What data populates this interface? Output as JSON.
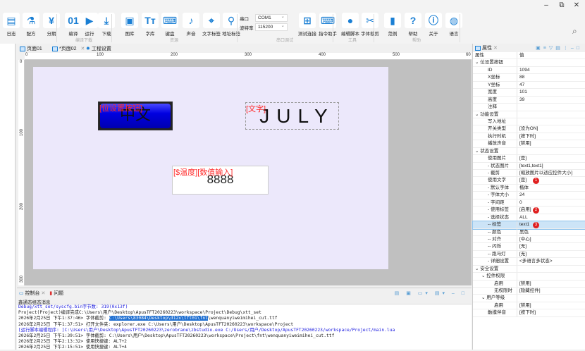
{
  "window": {
    "minimize": "–",
    "restore": "⧉",
    "close": "✕"
  },
  "ribbon": {
    "tools": [
      {
        "label": "日志",
        "icon": "log-icon",
        "glyph": "▤"
      },
      {
        "label": "配方",
        "icon": "recipe-icon",
        "glyph": "⚗"
      },
      {
        "label": "分期",
        "icon": "installment-icon",
        "glyph": "¥"
      },
      {
        "label": "编译",
        "icon": "compile-icon",
        "glyph": "01"
      },
      {
        "label": "运行",
        "icon": "run-icon",
        "glyph": "▶"
      },
      {
        "label": "下载",
        "icon": "download-icon",
        "glyph": "⤓"
      },
      {
        "label": "图库",
        "icon": "image-library-icon",
        "glyph": "▣"
      },
      {
        "label": "字库",
        "icon": "font-library-icon",
        "glyph": "Tт"
      },
      {
        "label": "键盘",
        "icon": "keyboard-icon",
        "glyph": "⌨"
      },
      {
        "label": "声音",
        "icon": "sound-icon",
        "glyph": "♪"
      },
      {
        "label": "文字标签",
        "icon": "text-tag-icon",
        "glyph": "⌖"
      },
      {
        "label": "地址标签",
        "icon": "address-tag-icon",
        "glyph": "⚲"
      },
      {
        "label": "测试连接",
        "icon": "test-connection-icon",
        "glyph": "⊞"
      },
      {
        "label": "指令助手",
        "icon": "command-helper-icon",
        "glyph": "⌨"
      },
      {
        "label": "编辑脚本",
        "icon": "lua-script-icon",
        "glyph": "●"
      },
      {
        "label": "字体裁剪",
        "icon": "scissors-icon",
        "glyph": "✂"
      },
      {
        "label": "范例",
        "icon": "bookmark-icon",
        "glyph": "▮"
      },
      {
        "label": "帮助",
        "icon": "help-icon",
        "glyph": "?"
      },
      {
        "label": "关于",
        "icon": "info-icon",
        "glyph": "ⓘ"
      },
      {
        "label": "语言",
        "icon": "globe-icon",
        "glyph": "◍"
      }
    ],
    "groups": [
      "编译下载",
      "资源",
      "串口调试",
      "工具",
      "帮助"
    ],
    "serial": {
      "port_label": "串口",
      "port_value": "COM1",
      "baud_label": "波特率",
      "baud_value": "115200"
    },
    "search": "⌕"
  },
  "tabs": [
    {
      "label": "页面01"
    },
    {
      "label": "*页面02"
    },
    {
      "label": "工程设置"
    }
  ],
  "ruler": {
    "h": [
      "0",
      "100",
      "200",
      "300",
      "400",
      "500",
      "60"
    ],
    "v": [
      "0",
      "100",
      "200",
      "300"
    ]
  },
  "canvas": {
    "button": {
      "tag": "[位设置按钮]",
      "text": "中文"
    },
    "text": {
      "tag": "[文字]",
      "text": "JULY"
    },
    "number": {
      "tag": "[$温度][数值输入]",
      "text": "8888"
    }
  },
  "props": {
    "title": "属性",
    "col_key": "属性",
    "col_val": "值",
    "rows": [
      {
        "k": "⌄ 位设置按钮",
        "v": ""
      },
      {
        "k": "ID",
        "v": "1094",
        "i": 2
      },
      {
        "k": "X坐标",
        "v": "88",
        "i": 2
      },
      {
        "k": "Y坐标",
        "v": "47",
        "i": 2
      },
      {
        "k": "宽度",
        "v": "101",
        "i": 2
      },
      {
        "k": "高度",
        "v": "39",
        "i": 2
      },
      {
        "k": "注释",
        "v": "",
        "i": 2
      },
      {
        "k": "⌄ 功能设置",
        "v": ""
      },
      {
        "k": "写入地址",
        "v": "",
        "i": 2
      },
      {
        "k": "开关类型",
        "v": "[设为ON]",
        "i": 2
      },
      {
        "k": "执行时机",
        "v": "[按下时]",
        "i": 2
      },
      {
        "k": "播放声音",
        "v": "[禁用]",
        "i": 2
      },
      {
        "k": "⌄ 状态设置",
        "v": ""
      },
      {
        "k": "使用图片",
        "v": "[是]",
        "i": 2
      },
      {
        "k": "- 状态图片",
        "v": "[text1,text1]",
        "i": 2
      },
      {
        "k": "- 截剪",
        "v": "[缩放图片以适应控件大小]",
        "i": 2
      },
      {
        "k": "使用文字",
        "v": "[是]",
        "i": 2,
        "badge": "1"
      },
      {
        "k": "- 默认字体",
        "v": "楷体",
        "i": 2
      },
      {
        "k": "- 字体大小",
        "v": "24",
        "i": 2
      },
      {
        "k": "- 字间距",
        "v": "0",
        "i": 2
      },
      {
        "k": "- 使用标签",
        "v": "[启用]",
        "i": 2,
        "badge": "2"
      },
      {
        "k": "- 选择状态",
        "v": "ALL",
        "i": 2
      },
      {
        "k": "-- 标签",
        "v": "text1",
        "i": 2,
        "badge": "3",
        "sel": true
      },
      {
        "k": "-- 颜色",
        "v": "黑色",
        "i": 2
      },
      {
        "k": "-- 对齐",
        "v": "[中心]",
        "i": 2
      },
      {
        "k": "-- 闪烁",
        "v": "[无]",
        "i": 2
      },
      {
        "k": "-- 跑马灯",
        "v": "[无]",
        "i": 2
      },
      {
        "k": "- 详细设置",
        "v": "<多语言多状态>",
        "i": 2
      },
      {
        "k": "⌄ 安全设置",
        "v": ""
      },
      {
        "k": "⌄ 控件权限",
        "v": "",
        "i": 1
      },
      {
        "k": "启用",
        "v": "[禁用]",
        "i": 3
      },
      {
        "k": "无权限时",
        "v": "[隐藏控件]",
        "i": 3
      },
      {
        "k": "⌄ 用户等级",
        "v": "",
        "i": 1
      },
      {
        "k": "启用",
        "v": "[禁用]",
        "i": 3
      },
      {
        "k": "触摸伴音",
        "v": "[按下时]",
        "i": 2
      }
    ]
  },
  "console": {
    "tab": "控制台",
    "tab2": "问题",
    "subtitle": "鑫通态组态消息",
    "lines": [
      {
        "t": "Debug/xtt_set/syscfg.bin字节数: 319(0x13f)",
        "c": "blue"
      },
      {
        "t": "Project(Project)编译完成C:\\Users\\用户\\Desktop\\ApusTFT20260223\\workspace\\Project\\Debug\\xtt_set"
      },
      {
        "pre": "2026年2月25日 下午1:37:46> 字体截剪: ",
        "hl": "C:\\Users\\83084\\Desktop\\d12x\\tft01\\fnt",
        "post": "\\wenquanyiweimihei_cut.ttf"
      },
      {
        "t": "2026年2月25日 下午1:37:51> 打开文件夹: explorer.exe C:\\Users\\用户\\Desktop\\ApusTFT20260223\\workspace\\Project"
      },
      {
        "t": "[运行脚本编辑程序: ]C:\\Users\\用户\\Desktop\\ApusTFT20260223\\zerobrane\\zbstudio.exe C:/Users/用户/Desktop/ApusTFT20260223/workspace/Project/main.lua",
        "c": "blue"
      },
      {
        "t": "2026年2月25日 下午1:39:51> 字体截剪: C:\\Users\\用户\\Desktop\\ApusTFT20260223\\workspace\\Project\\fnt\\wenquanyiweimihei_cut.ttf"
      },
      {
        "t": "2026年2月25日 下午2:13:32> 使用快捷键: ALT+2"
      },
      {
        "t": "2026年2月25日 下午2:15:51> 使用快捷键: ALT+4"
      }
    ]
  }
}
